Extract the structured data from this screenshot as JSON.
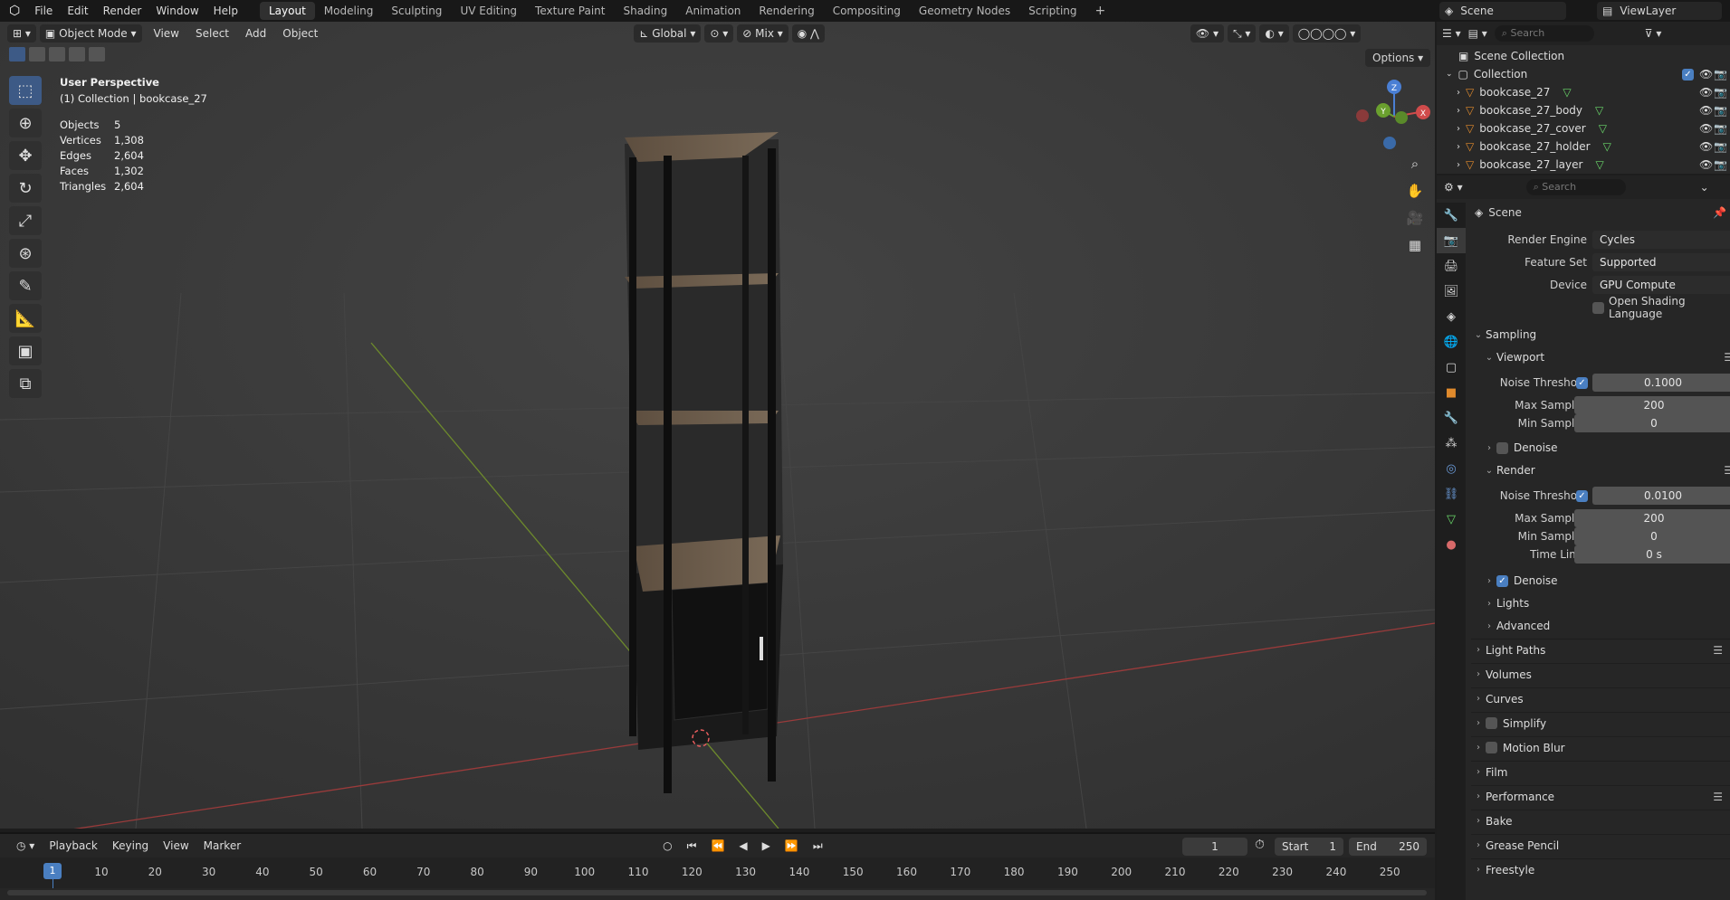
{
  "app_menu": [
    "File",
    "Edit",
    "Render",
    "Window",
    "Help"
  ],
  "workspaces": [
    "Layout",
    "Modeling",
    "Sculpting",
    "UV Editing",
    "Texture Paint",
    "Shading",
    "Animation",
    "Rendering",
    "Compositing",
    "Geometry Nodes",
    "Scripting"
  ],
  "active_workspace": "Layout",
  "scene_name": "Scene",
  "view_layer": "ViewLayer",
  "viewport": {
    "mode": "Object Mode",
    "menus": [
      "View",
      "Select",
      "Add",
      "Object"
    ],
    "orientation": "Global",
    "pivot_label": "Mix",
    "options": "Options",
    "perspective": "User Perspective",
    "collection_line": "(1) Collection | bookcase_27",
    "stats": [
      {
        "k": "Objects",
        "v": "5"
      },
      {
        "k": "Vertices",
        "v": "1,308"
      },
      {
        "k": "Edges",
        "v": "2,604"
      },
      {
        "k": "Faces",
        "v": "1,302"
      },
      {
        "k": "Triangles",
        "v": "2,604"
      }
    ],
    "gizmo": {
      "x": "X",
      "y": "Y",
      "z": "Z"
    }
  },
  "timeline": {
    "menus": [
      "Playback",
      "Keying",
      "View",
      "Marker"
    ],
    "current_frame": "1",
    "start_label": "Start",
    "start": "1",
    "end_label": "End",
    "end": "250",
    "ticks": [
      "10",
      "20",
      "30",
      "40",
      "50",
      "60",
      "70",
      "80",
      "90",
      "100",
      "110",
      "120",
      "130",
      "140",
      "150",
      "160",
      "170",
      "180",
      "190",
      "200",
      "210",
      "220",
      "230",
      "240",
      "250"
    ],
    "playhead": "1"
  },
  "outliner": {
    "search_placeholder": "Search",
    "scene_collection": "Scene Collection",
    "collection": "Collection",
    "items": [
      "bookcase_27",
      "bookcase_27_body",
      "bookcase_27_cover",
      "bookcase_27_holder",
      "bookcase_27_layer"
    ]
  },
  "properties": {
    "search_placeholder": "Search",
    "context": "Scene",
    "render_engine_label": "Render Engine",
    "render_engine": "Cycles",
    "feature_set_label": "Feature Set",
    "feature_set": "Supported",
    "device_label": "Device",
    "device": "GPU Compute",
    "osl_label": "Open Shading Language",
    "sampling": "Sampling",
    "viewport": "Viewport",
    "noise_threshold_label": "Noise Threshold",
    "vp_noise": "0.1000",
    "max_samples_label": "Max Samples",
    "vp_max": "200",
    "min_samples_label": "Min Samples",
    "vp_min": "0",
    "denoise": "Denoise",
    "render": "Render",
    "r_noise": "0.0100",
    "r_max": "200",
    "r_min": "0",
    "time_limit_label": "Time Limit",
    "time_limit": "0 s",
    "lights": "Lights",
    "advanced": "Advanced",
    "panels": [
      "Light Paths",
      "Volumes",
      "Curves",
      "Simplify",
      "Motion Blur",
      "Film",
      "Performance",
      "Bake",
      "Grease Pencil",
      "Freestyle"
    ]
  }
}
